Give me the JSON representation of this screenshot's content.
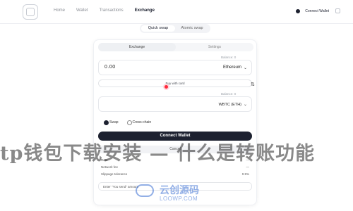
{
  "header": {
    "logo_icon": "app-logo-icon",
    "nav": [
      {
        "label": "Home",
        "active": false
      },
      {
        "label": "Wallet",
        "active": false
      },
      {
        "label": "Transactions",
        "active": false
      },
      {
        "label": "Exchange",
        "active": true
      }
    ],
    "connect_wallet_label": "Connect Wallet",
    "icons": [
      "settings-icon",
      "more-icon"
    ]
  },
  "mode_toggle": {
    "options": [
      "Quick swap",
      "Atomic swap"
    ],
    "selected": "Quick swap"
  },
  "card": {
    "tabs": [
      {
        "label": "Exchange",
        "active": true
      },
      {
        "label": "Settings",
        "active": false
      }
    ],
    "input": {
      "balance_label": "Balance: 0",
      "value": "0.00",
      "token": "Ethereum"
    },
    "buy_pill": "Buy with card",
    "output": {
      "balance_label": "Balance: 0",
      "token": "WBTC (ETH)"
    },
    "radios": [
      {
        "label": "Swap",
        "selected": true
      },
      {
        "label": "Cross-chain",
        "selected": false
      }
    ],
    "connect_button": "Connect Wallet",
    "secondary_button": "Cancel",
    "details": [
      {
        "label": "Rate",
        "value": "—"
      },
      {
        "label": "Network fee",
        "value": "—"
      },
      {
        "label": "Slippage tolerance",
        "value": "0.5%"
      }
    ],
    "referral_placeholder": "Enter \"You send\" amount"
  },
  "overlay_text": "tp钱包下载安装 — 什么是转账功能",
  "watermark": {
    "cn": "云创源码",
    "en": "LOOWP.COM"
  },
  "colors": {
    "primary": "#1d2130",
    "accent_dot": "#ff2a3c",
    "watermark": "#3a6fd3"
  }
}
